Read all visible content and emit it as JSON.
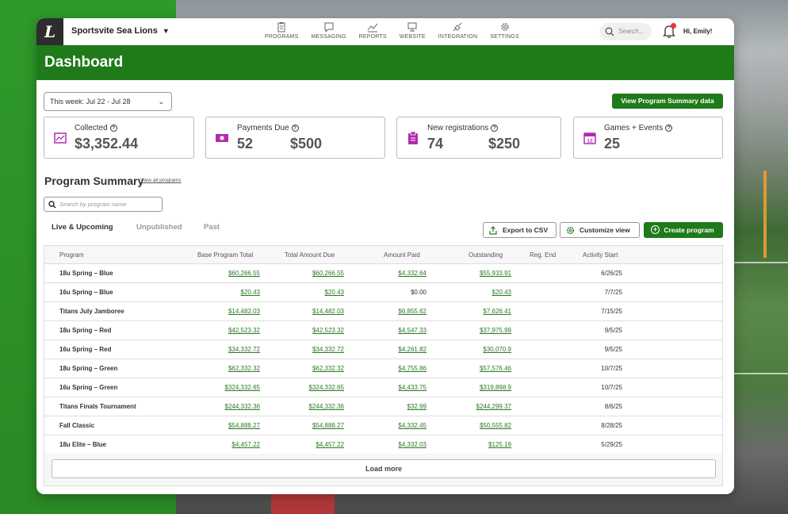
{
  "header": {
    "logo_letter": "L",
    "org_name": "Sportsvite Sea Lions",
    "nav": [
      {
        "label": "PROGRAMS",
        "icon": "clipboard-icon"
      },
      {
        "label": "MESSAGING",
        "icon": "chat-icon"
      },
      {
        "label": "REPORTS",
        "icon": "chart-line-icon"
      },
      {
        "label": "WEBSITE",
        "icon": "monitor-icon"
      },
      {
        "label": "INTEGRATION",
        "icon": "plug-icon"
      },
      {
        "label": "SETTINGS",
        "icon": "gear-icon"
      }
    ],
    "search_placeholder": "Search...",
    "greeting": "Hi, Emily!"
  },
  "page": {
    "title": "Dashboard"
  },
  "filters": {
    "week": "This week: Jul 22 - Jul 28",
    "summary_button": "View Program Summary data"
  },
  "stats": [
    {
      "label": "Collected",
      "value": "$3,352.44",
      "color": "#b02cb0"
    },
    {
      "label": "Payments Due",
      "value": "52",
      "value2": "$500",
      "color": "#b02cb0"
    },
    {
      "label": "New registrations",
      "value": "74",
      "value2": "$250",
      "color": "#b02cb0"
    },
    {
      "label": "Games + Events",
      "value": "25",
      "icon_num": "12",
      "color": "#b02cb0"
    }
  ],
  "program_summary": {
    "title": "Program Summary",
    "view_all": "View all programs",
    "search_placeholder": "Search by program name",
    "tabs": [
      "Live & Upcoming",
      "Unpublished",
      "Past"
    ],
    "active_tab": "Live & Upcoming",
    "export_label": "Export to CSV",
    "customize_label": "Customize view",
    "create_label": "Create program",
    "columns": [
      "Program",
      "Base Program Total",
      "Total Amount Due",
      "Amount Paid",
      "Outstanding",
      "Reg. End",
      "Activity Start"
    ],
    "rows": [
      [
        "18u Spring – Blue",
        "$60,266.55",
        "$60,266.55",
        "$4,332.64",
        "$55,933.91",
        "",
        "6/26/25"
      ],
      [
        "16u Spring – Blue",
        "$20.43",
        "$20.43",
        "$0.00",
        "$20.43",
        "",
        "7/7/25"
      ],
      [
        "Titans July Jamboree",
        "$14,482.03",
        "$14,482.03",
        "$6,855.62",
        "$7,626.41",
        "",
        "7/15/25"
      ],
      [
        "18u Spring – Red",
        "$42,523.32",
        "$42,523.32",
        "$4,547.33",
        "$37,975.99",
        "",
        "9/5/25"
      ],
      [
        "16u Spring – Red",
        "$34,332.72",
        "$34,332.72",
        "$4,261.82",
        "$30,070.9",
        "",
        "9/5/25"
      ],
      [
        "18u Spring – Green",
        "$62,332.32",
        "$62,332.32",
        "$4,755.86",
        "$57,576.46",
        "",
        "10/7/25"
      ],
      [
        "16u Spring – Green",
        "$324,332.65",
        "$324,332.65",
        "$4,433.75",
        "$319,898.9",
        "",
        "10/7/25"
      ],
      [
        "Titans Finals Tournament",
        "$244,332.36",
        "$244,332.36",
        "$32.99",
        "$244,299.37",
        "",
        "8/6/25"
      ],
      [
        "Fall Classic",
        "$54,888.27",
        "$54,888.27",
        "$4,332.45",
        "$50,555.82",
        "",
        "8/28/25"
      ],
      [
        "18u Elite – Blue",
        "$4,457.22",
        "$4,457.22",
        "$4,332.03",
        "$125.19",
        "",
        "5/29/25"
      ]
    ],
    "load_more": "Load more"
  },
  "colors": {
    "brand_green": "#1f7a1a",
    "accent_magenta": "#b02cb0",
    "link_green": "#2a7a24"
  }
}
